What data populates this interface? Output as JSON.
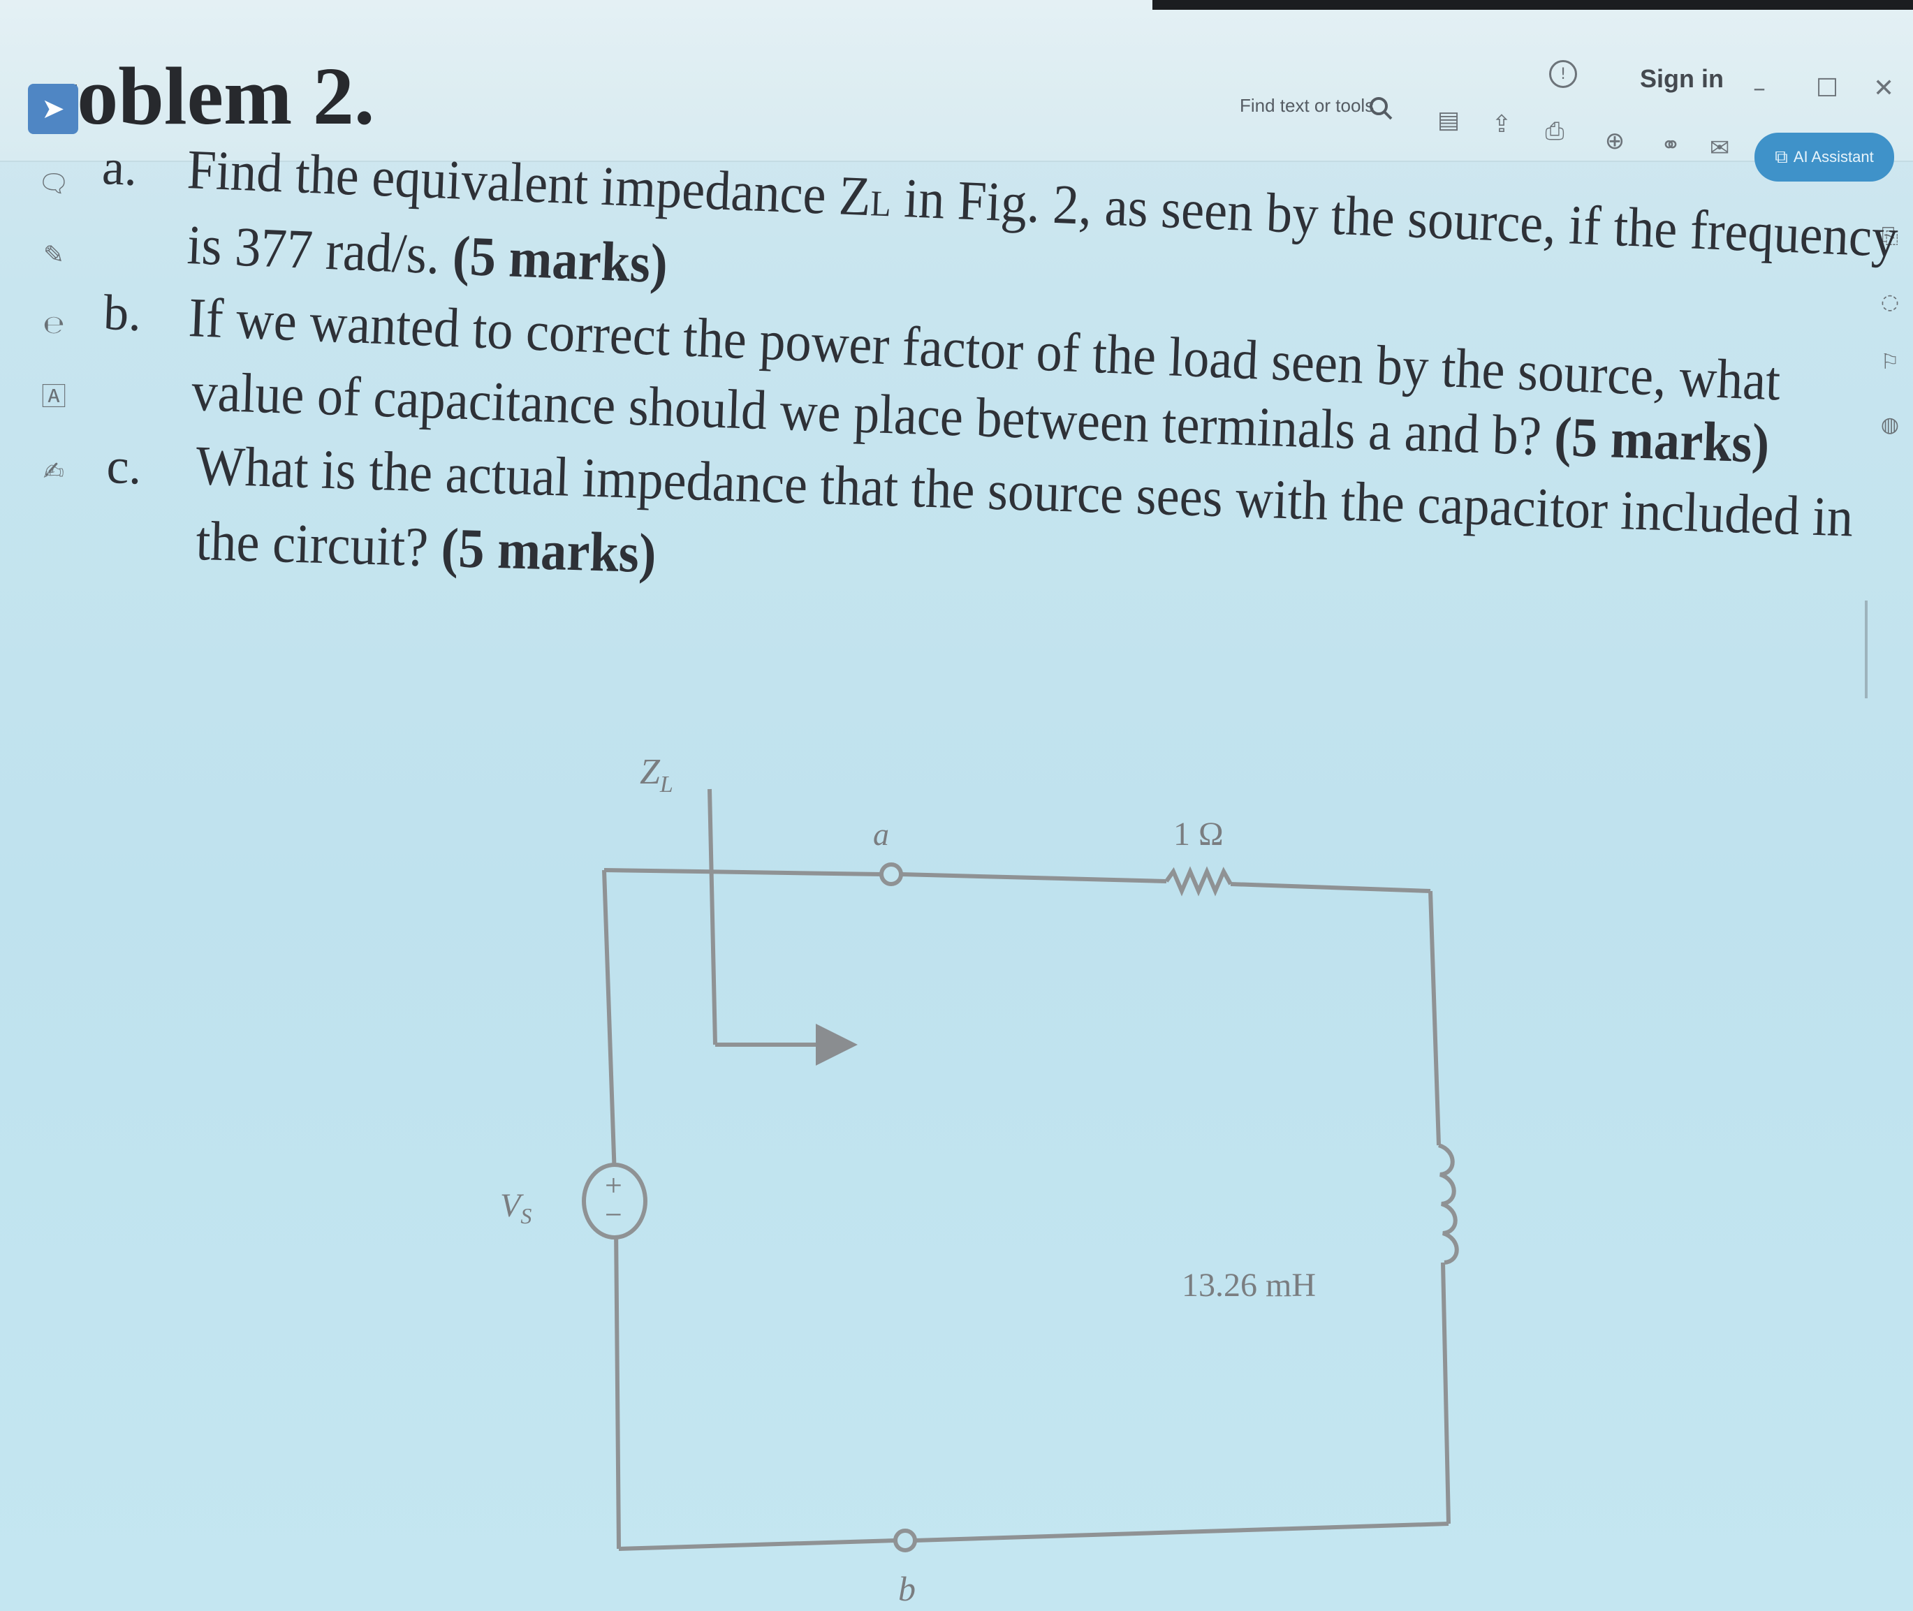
{
  "toolbar": {
    "title": "roblem 2.",
    "find_label": "Find text or tools",
    "sign_in_label": "Sign in",
    "ai_assistant_label": "AI Assistant",
    "help_icon": "info-circle-icon",
    "minimize_glyph": "–",
    "maximize_glyph": "☐",
    "close_glyph": "✕"
  },
  "problem": {
    "a": {
      "label": "a.",
      "line1_pre": "Find the equivalent impedance Z",
      "line1_sub": "L",
      "line1_post": " in Fig. 2, as seen by the source, if the frequency",
      "line2_text": "is 377 rad/s. ",
      "marks": "(5 marks)"
    },
    "b": {
      "label": "b.",
      "line1": "If we wanted to correct the power factor of the load seen by the source, what",
      "line2": "value of capacitance should we place between terminals a and b? ",
      "marks": "(5 marks)"
    },
    "c": {
      "label": "c.",
      "line1": "What is the actual impedance that the source sees with the capacitor included in",
      "line2": "the circuit? ",
      "marks": "(5 marks)"
    }
  },
  "circuit": {
    "zl_label": "Z",
    "zl_sub": "L",
    "terminal_a": "a",
    "terminal_b": "b",
    "resistor_label": "1 Ω",
    "inductor_label": "13.26 mH",
    "source_label": "V",
    "source_sub": "S",
    "source_plus": "+",
    "source_minus": "−"
  }
}
